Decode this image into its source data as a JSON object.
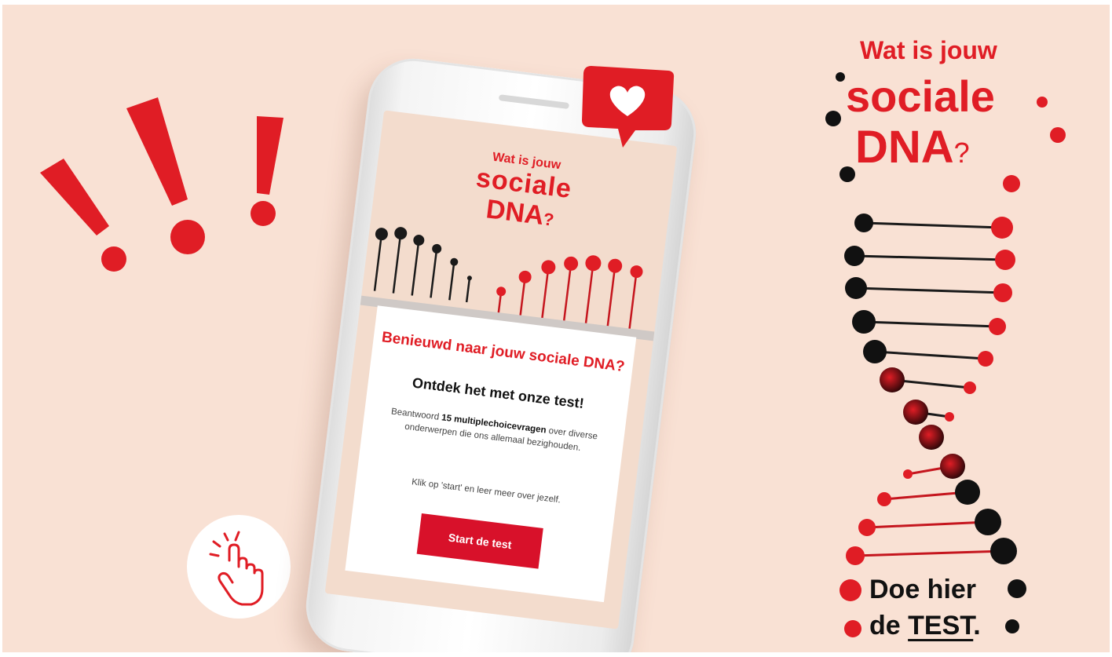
{
  "phone": {
    "title_line1": "Wat is jouw",
    "title_line2": "sociale",
    "title_line3": "DNA",
    "title_q": "?",
    "card": {
      "heading": "Benieuwd naar jouw sociale DNA?",
      "subheading": "Ontdek het met onze test!",
      "body_pre": "Beantwoord ",
      "body_bold": "15 multiplechoicevragen",
      "body_post": " over diverse onderwerpen die ons allemaal bezighouden.",
      "cta_text": "Klik op 'start' en leer meer over jezelf.",
      "button_label": "Start de test"
    }
  },
  "poster": {
    "title_line1": "Wat is jouw",
    "title_line2": "sociale",
    "title_line3": "DNA",
    "title_q": "?",
    "cta_line1": "Doe hier",
    "cta_line2_pre": "de ",
    "cta_line2_link": "TEST",
    "cta_line2_post": "."
  },
  "icons": {
    "exclamation": "exclamation-marks-icon",
    "heart": "heart-bubble-icon",
    "hand": "pointing-hand-icon",
    "dna": "dna-helix-icon"
  },
  "colors": {
    "background": "#f9e1d4",
    "red": "#e01d25",
    "button": "#d8112a",
    "dark": "#111111"
  }
}
